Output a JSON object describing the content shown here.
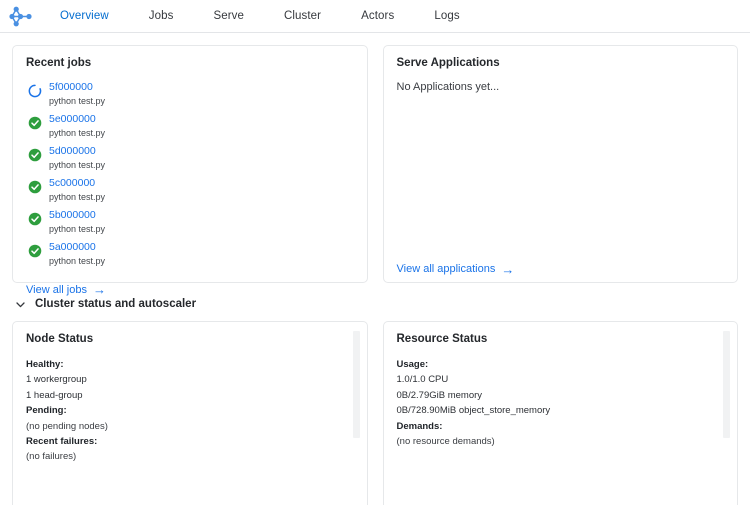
{
  "nav": {
    "logo_icon": "ray-logo-icon",
    "items": [
      {
        "label": "Overview",
        "active": true
      },
      {
        "label": "Jobs",
        "active": false
      },
      {
        "label": "Serve",
        "active": false
      },
      {
        "label": "Cluster",
        "active": false
      },
      {
        "label": "Actors",
        "active": false
      },
      {
        "label": "Logs",
        "active": false
      }
    ]
  },
  "recent_jobs": {
    "title": "Recent jobs",
    "jobs": [
      {
        "id": "5f000000",
        "entrypoint": "python test.py",
        "status": "running",
        "icon": "spinner-icon"
      },
      {
        "id": "5e000000",
        "entrypoint": "python test.py",
        "status": "succeeded",
        "icon": "check-circle-icon"
      },
      {
        "id": "5d000000",
        "entrypoint": "python test.py",
        "status": "succeeded",
        "icon": "check-circle-icon"
      },
      {
        "id": "5c000000",
        "entrypoint": "python test.py",
        "status": "succeeded",
        "icon": "check-circle-icon"
      },
      {
        "id": "5b000000",
        "entrypoint": "python test.py",
        "status": "succeeded",
        "icon": "check-circle-icon"
      },
      {
        "id": "5a000000",
        "entrypoint": "python test.py",
        "status": "succeeded",
        "icon": "check-circle-icon"
      }
    ],
    "view_all_label": "View all jobs",
    "arrow_glyph": "→"
  },
  "serve": {
    "title": "Serve Applications",
    "empty_message": "No Applications yet...",
    "view_all_label": "View all applications",
    "arrow_glyph": "→"
  },
  "cluster_section": {
    "label": "Cluster status and autoscaler",
    "expanded": true,
    "chevron_icon": "chevron-down-icon"
  },
  "node_status": {
    "title": "Node Status",
    "healthy_label": "Healthy:",
    "healthy_lines": [
      "1 workergroup",
      "1 head-group"
    ],
    "pending_label": "Pending:",
    "pending_lines": [
      "(no pending nodes)"
    ],
    "failures_label": "Recent failures:",
    "failures_lines": [
      "(no failures)"
    ]
  },
  "resource_status": {
    "title": "Resource Status",
    "usage_label": "Usage:",
    "usage_lines": [
      "1.0/1.0 CPU",
      "0B/2.79GiB memory",
      "0B/728.90MiB object_store_memory"
    ],
    "demands_label": "Demands:",
    "demands_lines": [
      "(no resource demands)"
    ]
  },
  "colors": {
    "accent_blue": "#1a73e8",
    "nav_active": "#036dcf",
    "success_green": "#2e9e3e",
    "border": "#e6e8ea",
    "scrollbar_thumb": "#f1f2f3"
  }
}
